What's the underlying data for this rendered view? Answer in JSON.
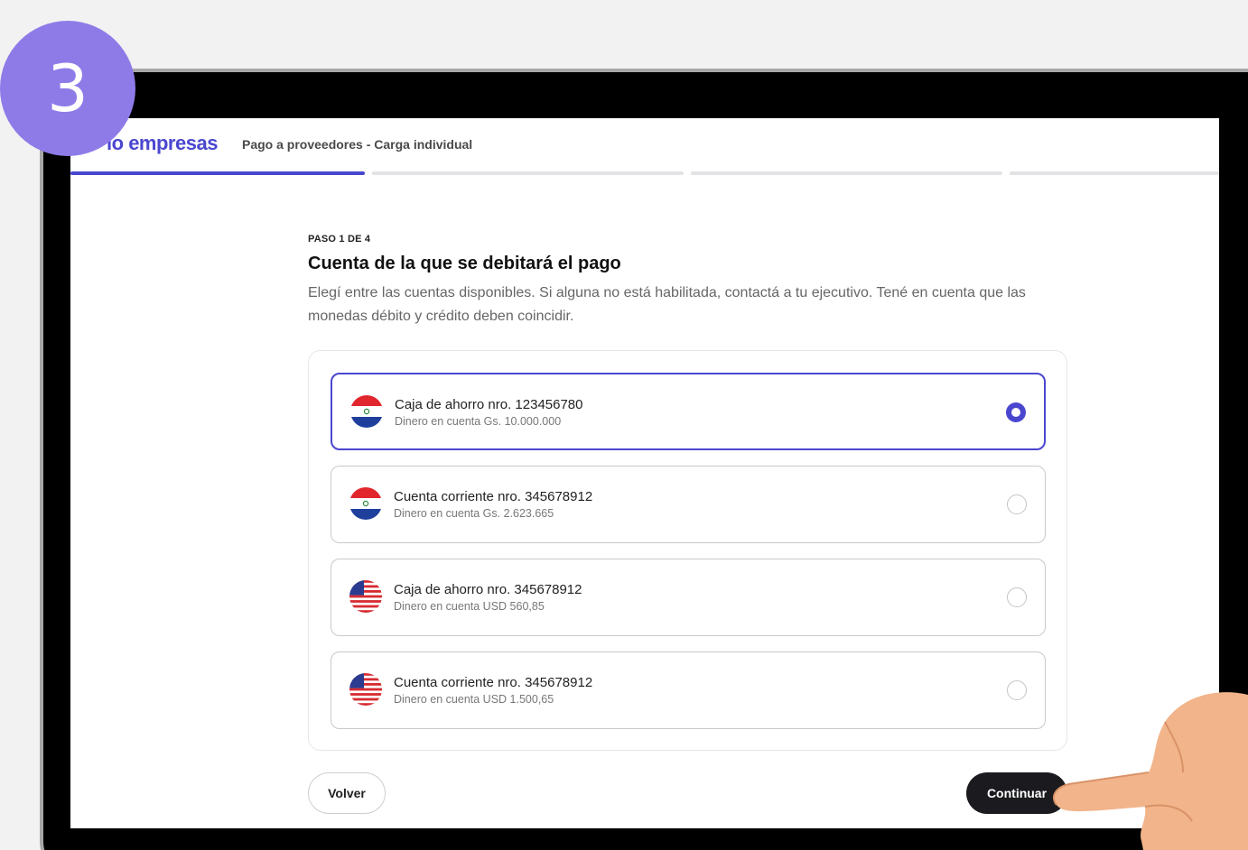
{
  "tutorial": {
    "step_number": "3"
  },
  "header": {
    "brand": "empresas",
    "brand_prefix": "lo",
    "subtitle": "Pago a proveedores - Carga individual"
  },
  "progress": {
    "total_steps": 4,
    "current_step": 1
  },
  "page": {
    "step_label": "PASO 1 DE 4",
    "title": "Cuenta de la que se debitará el pago",
    "description": "Elegí entre las cuentas disponibles. Si alguna no está habilitada, contactá a tu ejecutivo. Tené en cuenta que las monedas débito y crédito deben coincidir."
  },
  "accounts": [
    {
      "title": "Caja de ahorro nro. 123456780",
      "subtitle": "Dinero en cuenta Gs. 10.000.000",
      "flag": "paraguay-flag-icon",
      "selected": true
    },
    {
      "title": "Cuenta corriente nro. 345678912",
      "subtitle": "Dinero en cuenta Gs. 2.623.665",
      "flag": "paraguay-flag-icon",
      "selected": false
    },
    {
      "title": "Caja de ahorro nro. 345678912",
      "subtitle": "Dinero en cuenta USD 560,85",
      "flag": "usa-flag-icon",
      "selected": false
    },
    {
      "title": "Cuenta corriente  nro. 345678912",
      "subtitle": "Dinero en cuenta USD 1.500,65",
      "flag": "usa-flag-icon",
      "selected": false
    }
  ],
  "actions": {
    "back_label": "Volver",
    "continue_label": "Continuar"
  },
  "colors": {
    "accent": "#4a47cf",
    "badge": "#8f7be8",
    "primary_button": "#1b1b1f"
  }
}
